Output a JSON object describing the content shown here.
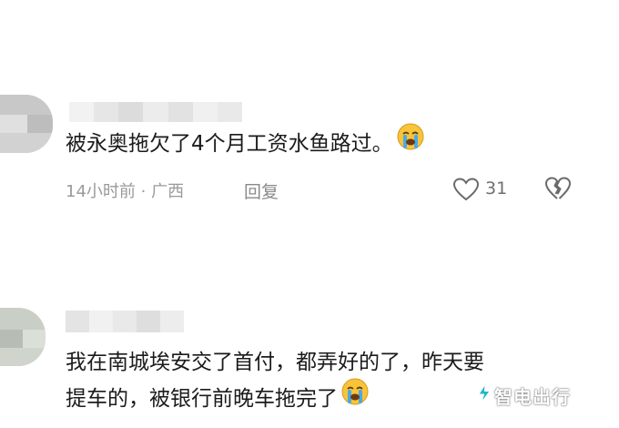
{
  "comments": [
    {
      "text": "被永奥拖欠了4个月工资水鱼路过。",
      "emoji": "crying-face",
      "time_location": "14小时前 · 广西",
      "reply_label": "回复",
      "like_count": "31"
    },
    {
      "text_line1": "我在南城埃安交了首付，都弄好的了，昨天要",
      "text_line2": "提车的，被银行前晚车拖完了",
      "emoji": "crying-face"
    }
  ],
  "watermark": {
    "text": "智电出行"
  },
  "icons": {
    "like": "heart-outline-icon",
    "dislike": "broken-heart-icon",
    "emoji": "loudly-crying-face-icon"
  },
  "colors": {
    "text": "#1b1b1b",
    "meta": "#9a9a9a",
    "emoji_face": "#f7c43a",
    "tears": "#4aa8e8"
  }
}
